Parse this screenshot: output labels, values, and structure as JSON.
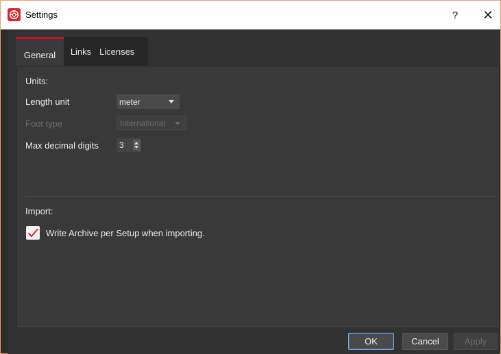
{
  "window": {
    "title": "Settings",
    "help_label": "?",
    "close_label": "✕"
  },
  "tabs": [
    {
      "label": "General",
      "active": true
    },
    {
      "label": "Links",
      "active": false
    },
    {
      "label": "Licenses",
      "active": false
    }
  ],
  "units": {
    "heading": "Units:",
    "length_unit_label": "Length unit",
    "length_unit_value": "meter",
    "foot_type_label": "Foot type",
    "foot_type_value": "International",
    "max_decimal_label": "Max decimal digits",
    "max_decimal_value": "3"
  },
  "import": {
    "heading": "Import:",
    "write_archive_label": "Write Archive per Setup when importing.",
    "write_archive_checked": true
  },
  "buttons": {
    "ok": "OK",
    "cancel": "Cancel",
    "apply": "Apply"
  },
  "colors": {
    "accent": "#c8102e",
    "background": "#393939",
    "check": "#d7262e"
  }
}
